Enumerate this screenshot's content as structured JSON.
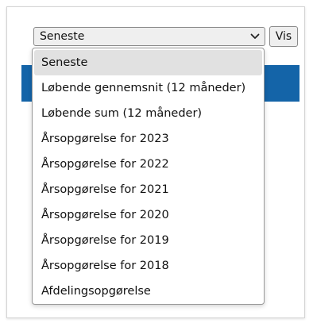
{
  "select": {
    "value": "Seneste",
    "chevron_icon": "chevron-down-icon"
  },
  "vis_button": {
    "label": "Vis"
  },
  "dropdown": {
    "options": [
      {
        "label": "Seneste",
        "selected": true
      },
      {
        "label": "Løbende gennemsnit (12 måneder)",
        "selected": false
      },
      {
        "label": "Løbende sum (12 måneder)",
        "selected": false
      },
      {
        "label": "Årsopgørelse for 2023",
        "selected": false
      },
      {
        "label": "Årsopgørelse for 2022",
        "selected": false
      },
      {
        "label": "Årsopgørelse for 2021",
        "selected": false
      },
      {
        "label": "Årsopgørelse for 2020",
        "selected": false
      },
      {
        "label": "Årsopgørelse for 2019",
        "selected": false
      },
      {
        "label": "Årsopgørelse for 2018",
        "selected": false
      },
      {
        "label": "Afdelingsopgørelse",
        "selected": false
      }
    ]
  },
  "colors": {
    "accent_band": "#1464a8",
    "selected_option_bg": "#e1e1e1"
  }
}
